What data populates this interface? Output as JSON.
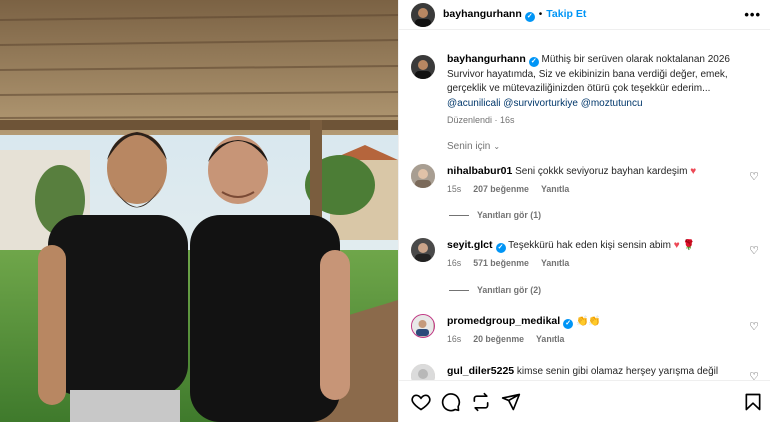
{
  "post": {
    "username": "bayhangurhann",
    "follow_label": "Takip Et",
    "separator": "•",
    "more_label": "•••"
  },
  "caption": {
    "username": "bayhangurhann",
    "text": "Müthiş bir serüven olarak noktalanan 2026 Survivor hayatımda, Siz ve ekibinizin bana verdiği değer, emek, gerçeklik ve mütevaziliğinizden ötürü çok teşekkür ederim...",
    "mentions": [
      "@acunilicali",
      "@survivorturkiye",
      "@moztutuncu"
    ],
    "edited_label": "Düzenlendi",
    "time": "16s"
  },
  "sort_label": "Senin için",
  "comments": [
    {
      "username": "nihalbabur01",
      "text": "Seni çokkk seviyoruz bayhan kardeşim",
      "emoji": "♥",
      "time": "15s",
      "likes": "207 beğenme",
      "reply": "Yanıtla",
      "replies": "Yanıtları gör (1)"
    },
    {
      "username": "seyit.glct",
      "text": "Teşekkürü hak eden kişi sensin abim",
      "emoji": "♥ 🌹",
      "time": "16s",
      "likes": "571 beğenme",
      "reply": "Yanıtla",
      "replies": "Yanıtları gör (2)"
    },
    {
      "username": "promedgroup_medikal",
      "text": "",
      "emoji": "👏👏",
      "time": "16s",
      "likes": "20 beğenme",
      "reply": "Yanıtla"
    },
    {
      "username": "gul_diler5225",
      "text": "kimse senin gibi olamaz herşey yarışma değil",
      "time": "",
      "likes": "",
      "reply": ""
    }
  ],
  "icons": {
    "like": "heart-icon",
    "comment": "comment-icon",
    "repost": "repost-icon",
    "share": "share-icon",
    "save": "bookmark-icon"
  },
  "colors": {
    "link": "#0095f6",
    "mention": "#00376b",
    "meta": "#737373",
    "heart": "#ed4956"
  }
}
